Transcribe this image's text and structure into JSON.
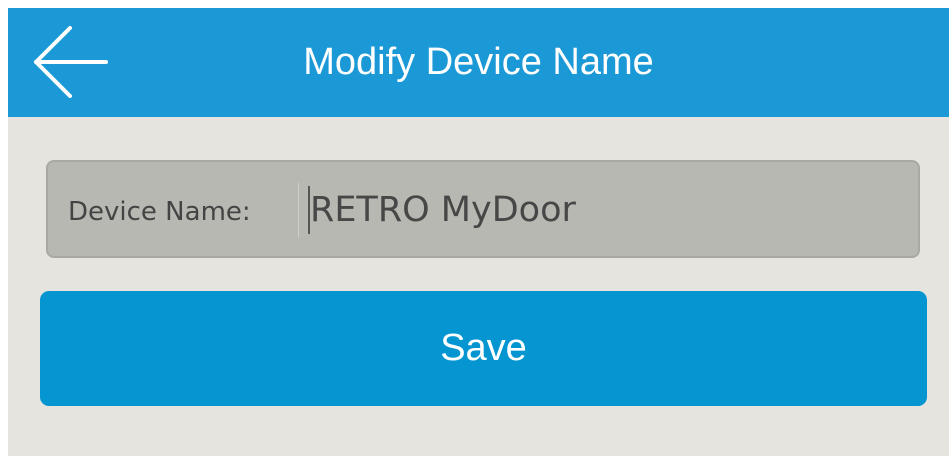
{
  "header": {
    "title": "Modify Device Name",
    "back_icon": "arrow-left-icon"
  },
  "form": {
    "label": "Device Name:",
    "value": "RETRO MyDoor",
    "placeholder": ""
  },
  "actions": {
    "save_label": "Save"
  },
  "colors": {
    "header_bg": "#1b98d6",
    "page_bg": "#e6e4df",
    "field_bg": "#b8b8b3",
    "button_bg": "#0596d1",
    "text_on_primary": "#ffffff"
  }
}
